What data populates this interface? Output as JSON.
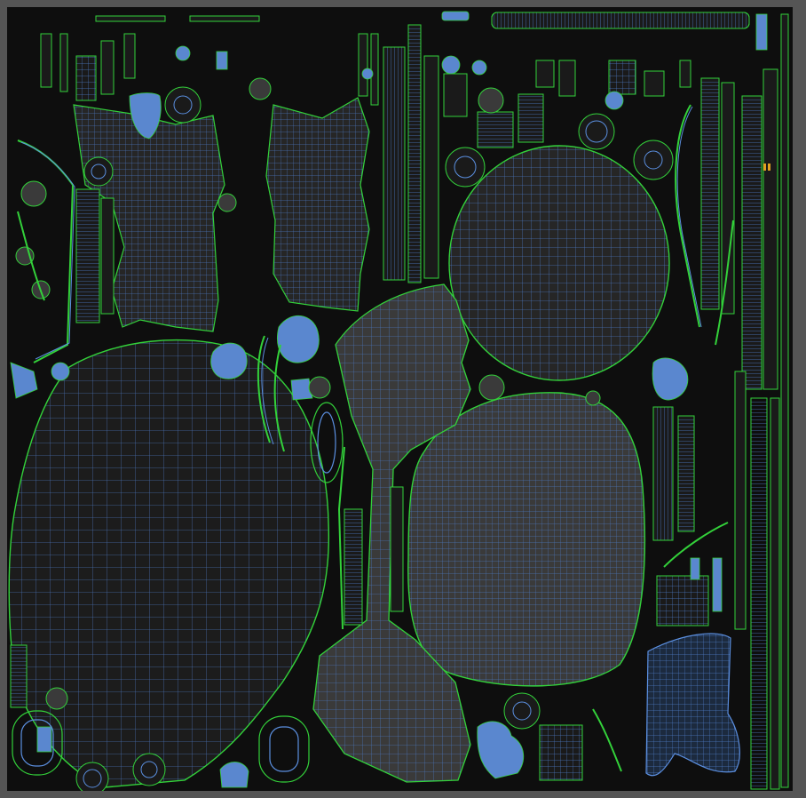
{
  "view": {
    "kind": "uv-layout-viewport",
    "colors": {
      "frame": "#555555",
      "background": "#0e0e0e",
      "island_fill": "#262626",
      "island_fill_light": "#3a3a3a",
      "island_fill_dark": "#1c1c1c",
      "border": "#33d13a",
      "wire": "#5b8fe0",
      "solid": "#5a87cf",
      "accent": "#e0a020"
    }
  }
}
